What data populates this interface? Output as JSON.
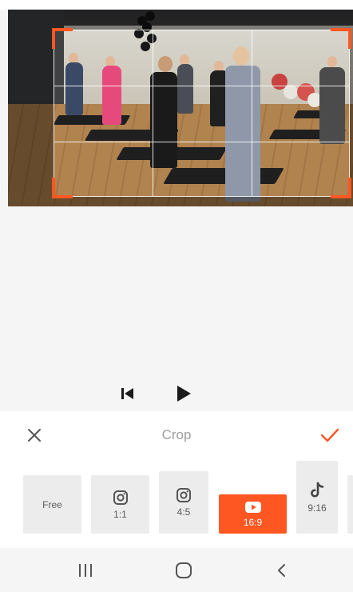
{
  "crop_panel": {
    "title": "Crop",
    "cancel_icon": "close-icon",
    "confirm_icon": "check-icon"
  },
  "playback": {
    "previous_icon": "skip-previous-icon",
    "play_icon": "play-icon"
  },
  "aspect_ratios": [
    {
      "label": "Free",
      "icon": "",
      "selected": false
    },
    {
      "label": "1:1",
      "icon": "instagram-icon",
      "selected": false
    },
    {
      "label": "4:5",
      "icon": "instagram-icon",
      "selected": false
    },
    {
      "label": "16:9",
      "icon": "youtube-icon",
      "selected": true
    },
    {
      "label": "9:16",
      "icon": "tiktok-icon",
      "selected": false
    }
  ],
  "nav_bar": {
    "recents_icon": "recents-icon",
    "home_icon": "home-icon",
    "back_icon": "back-icon"
  },
  "colors": {
    "accent": "#ff5722",
    "panel_background": "#ffffff",
    "tile_background": "#ececec",
    "title_text": "#9e9e9e"
  }
}
